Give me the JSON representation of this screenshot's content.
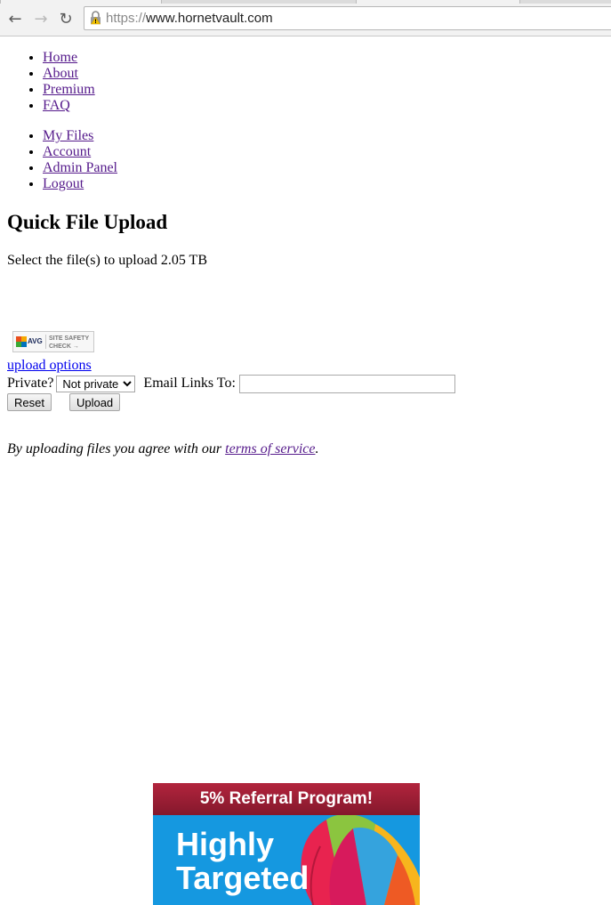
{
  "browser": {
    "url_scheme": "https://",
    "url_host": "www.hornetvault.com",
    "back_icon": "arrow-left-icon",
    "forward_icon": "arrow-right-icon",
    "reload_icon": "reload-icon",
    "lock_icon": "lock-warning-icon"
  },
  "menus": {
    "primary": [
      {
        "label": "Home"
      },
      {
        "label": "About"
      },
      {
        "label": "Premium"
      },
      {
        "label": "FAQ"
      }
    ],
    "secondary": [
      {
        "label": "My Files"
      },
      {
        "label": "Account"
      },
      {
        "label": "Admin Panel"
      },
      {
        "label": "Logout"
      }
    ]
  },
  "upload": {
    "title": "Quick File Upload",
    "select_text": "Select the file(s) to upload 2.05 TB",
    "badge": {
      "brand": "AVG",
      "line1": "SITE SAFETY",
      "line2": "CHECK →"
    },
    "options_link": "upload options",
    "private_label": "Private?",
    "private_selected": "Not private",
    "email_label": "Email Links To:",
    "email_value": "",
    "reset_label": "Reset",
    "upload_label": "Upload",
    "tos_prefix": "By uploading files you agree with our ",
    "tos_link": "terms of service",
    "tos_suffix": "."
  },
  "ad": {
    "banner_text": "5% Referral Program!",
    "headline_line1": "Highly",
    "headline_line2": "Targeted",
    "colors": {
      "banner": "#a51e36",
      "body": "#1598e0"
    }
  },
  "colors": {
    "link": "#0000ee",
    "visited_link": "#551a8b"
  }
}
